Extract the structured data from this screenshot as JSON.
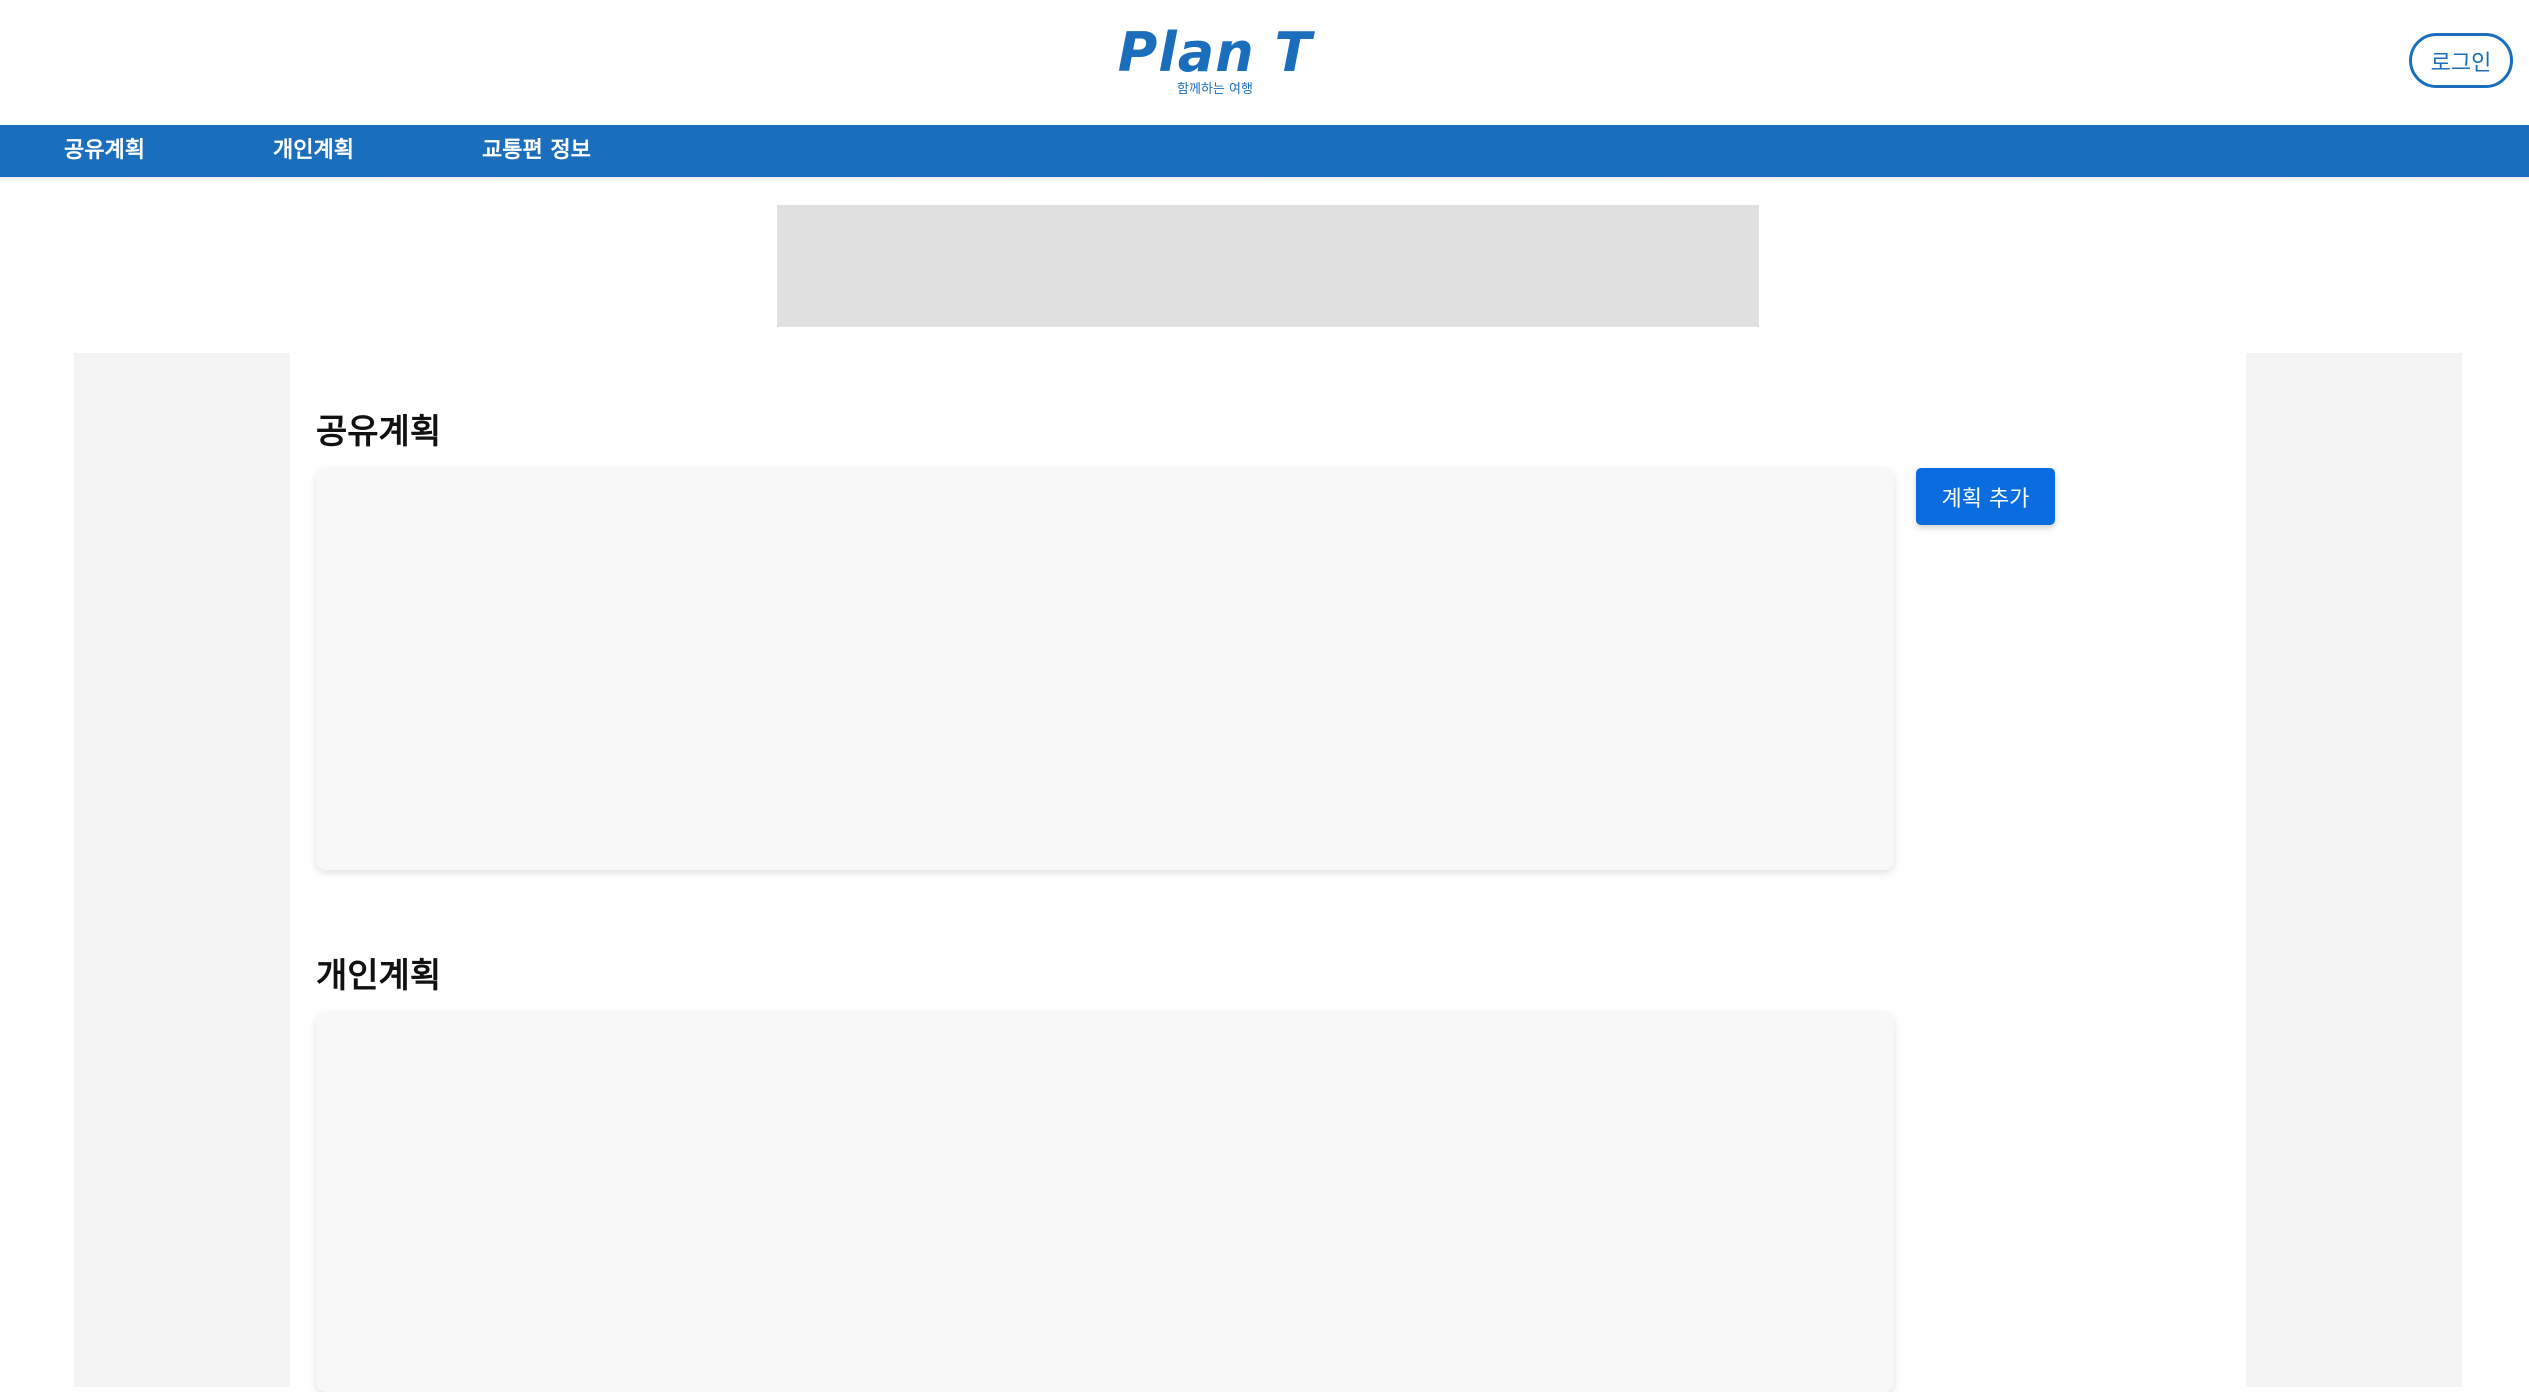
{
  "header": {
    "logo_title": "Plan T",
    "logo_subtitle": "함께하는 여행",
    "login_label": "로그인"
  },
  "nav": {
    "items": [
      {
        "label": "공유계획"
      },
      {
        "label": "개인계획"
      },
      {
        "label": "교통편 정보"
      }
    ]
  },
  "main": {
    "shared_section": {
      "title": "공유계획",
      "add_button_label": "계획 추가"
    },
    "personal_section": {
      "title": "개인계획"
    }
  },
  "colors": {
    "brand": "#1b6ebc",
    "button": "#0a6ddf",
    "panel_bg": "#f8f8f8",
    "side_bg": "#f3f3f3",
    "banner_bg": "#e0e0e0"
  }
}
